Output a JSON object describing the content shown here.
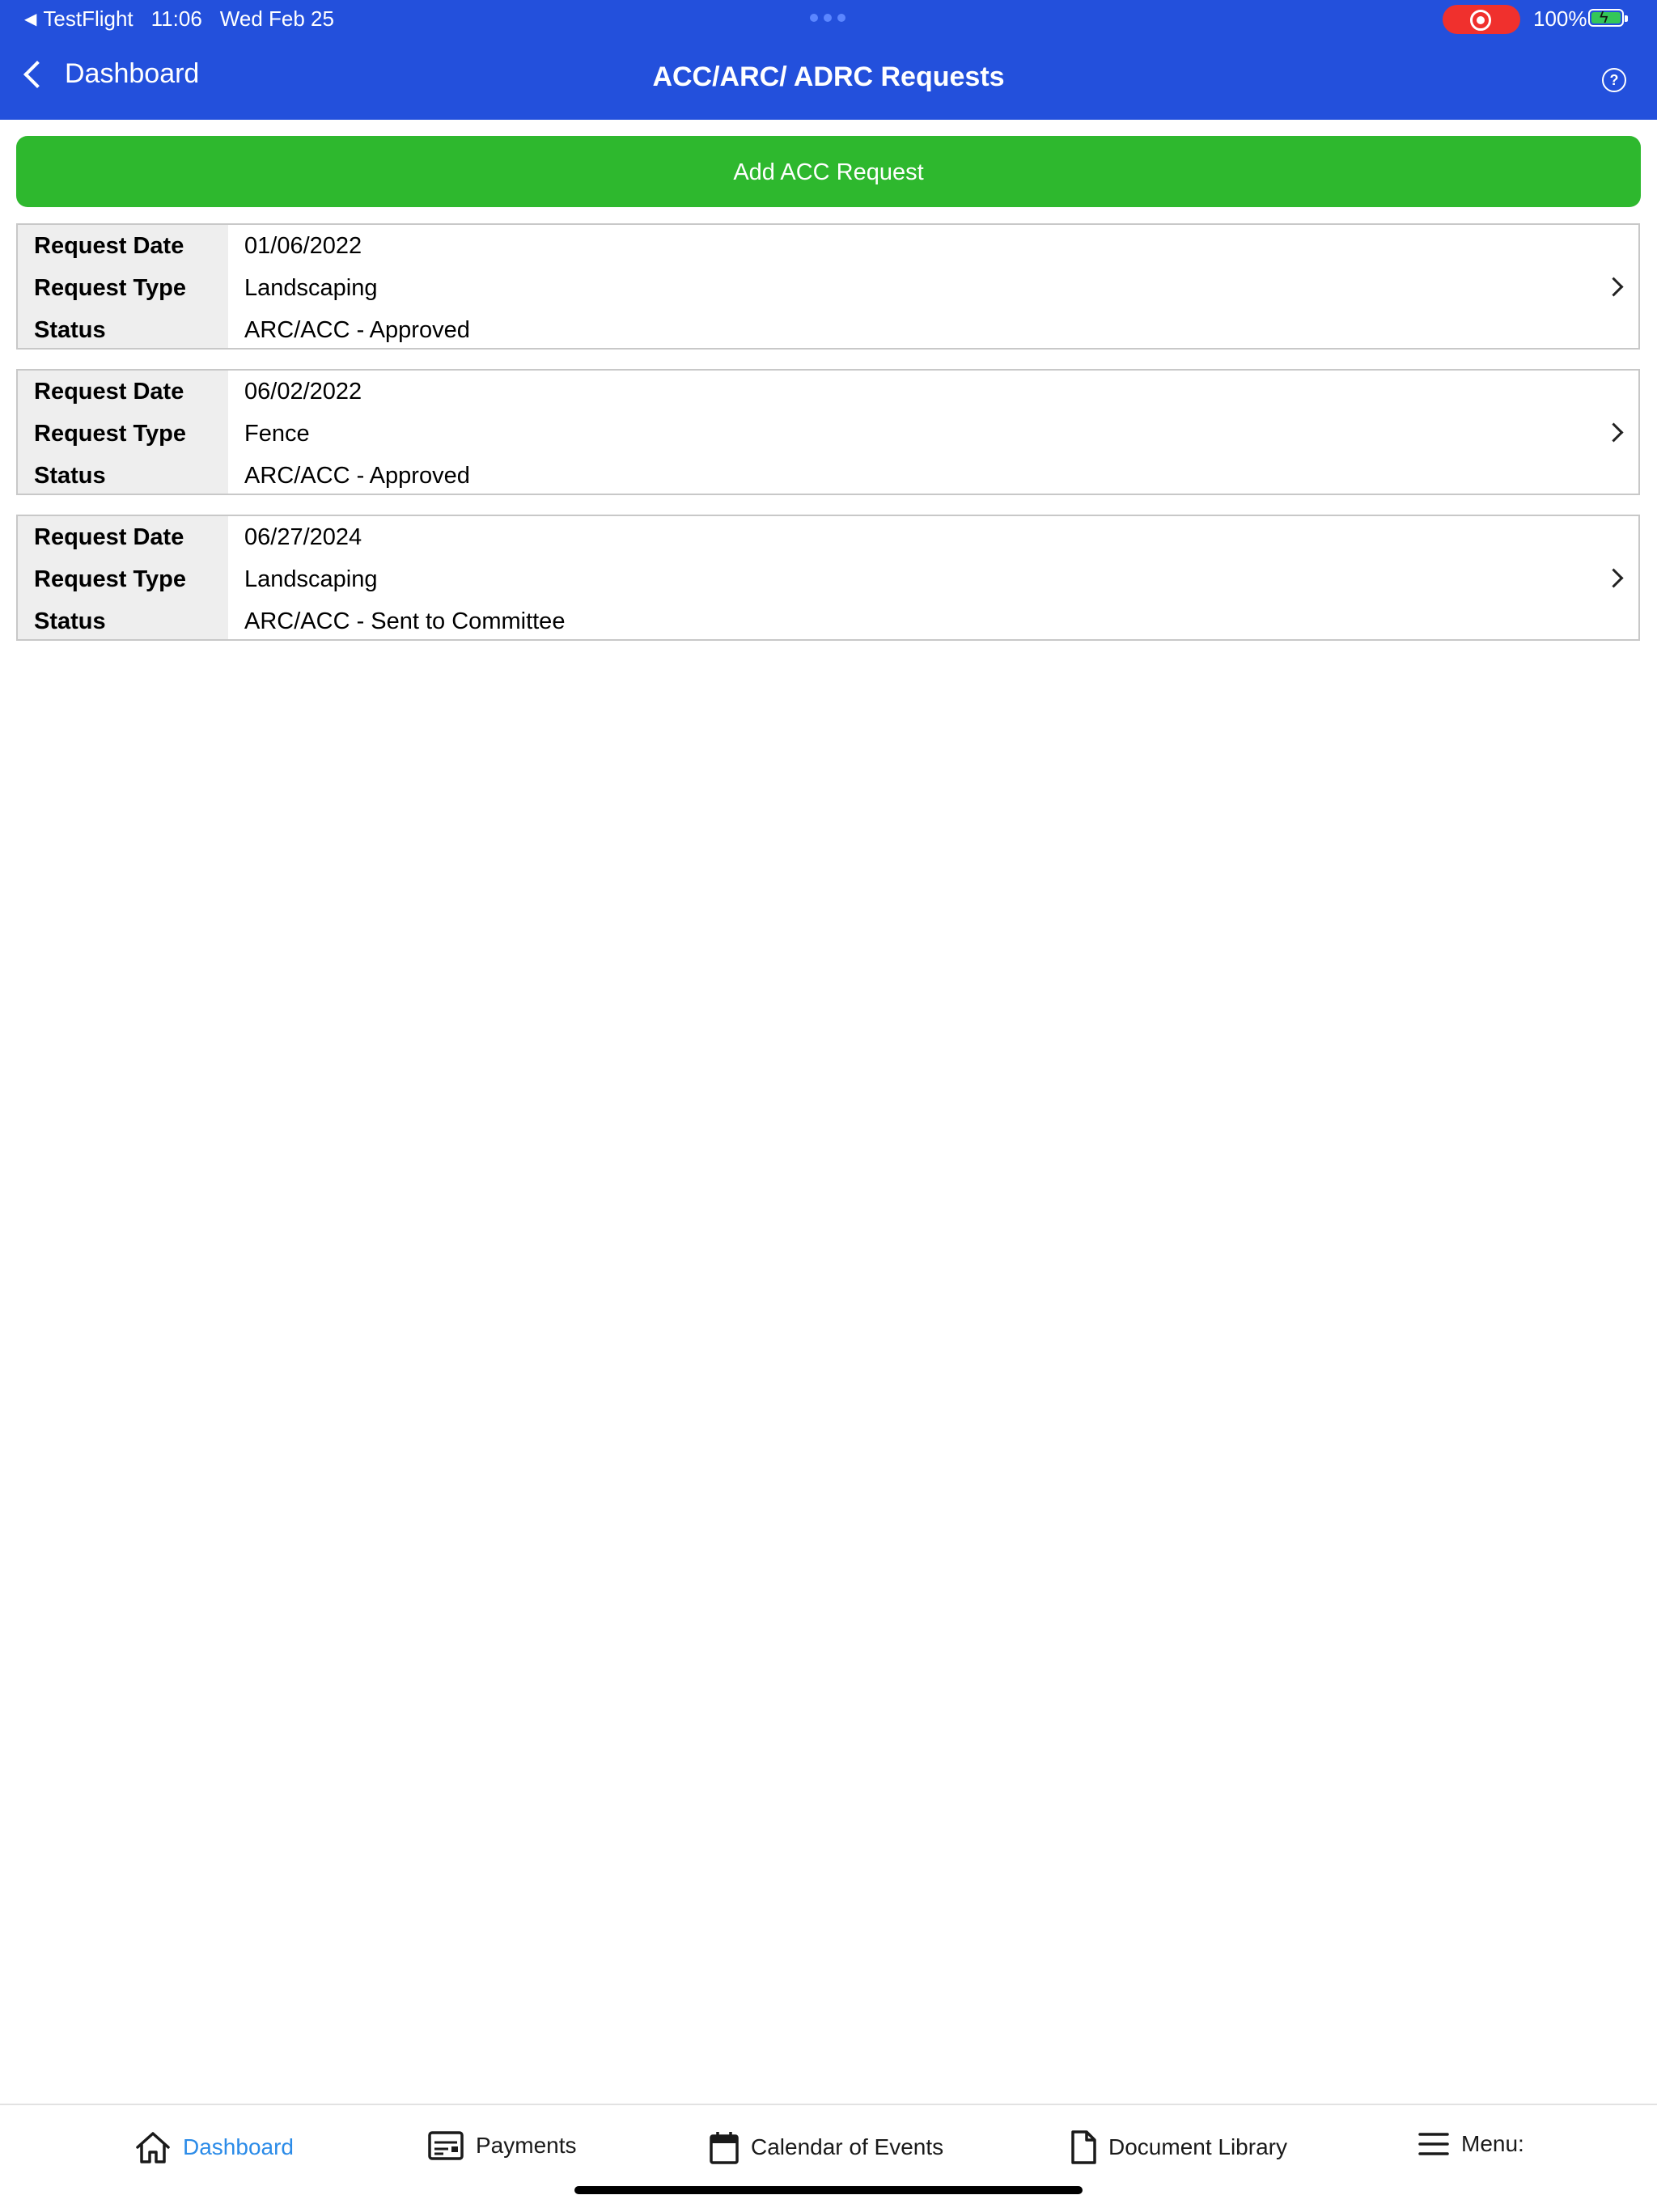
{
  "status_bar": {
    "back_app": "TestFlight",
    "time": "11:06",
    "date": "Wed Feb 25",
    "battery": "100%"
  },
  "nav": {
    "back_label": "Dashboard",
    "title": "ACC/ARC/ ADRC Requests"
  },
  "add_button_label": "Add ACC Request",
  "field_labels": {
    "request_date": "Request Date",
    "request_type": "Request Type",
    "status": "Status"
  },
  "requests": [
    {
      "date": "01/06/2022",
      "type": "Landscaping",
      "status": "ARC/ACC - Approved"
    },
    {
      "date": "06/02/2022",
      "type": "Fence",
      "status": "ARC/ACC - Approved"
    },
    {
      "date": "06/27/2024",
      "type": "Landscaping",
      "status": "ARC/ACC - Sent to Committee"
    }
  ],
  "tabs": [
    {
      "label": "Dashboard",
      "icon": "home-icon",
      "active": true
    },
    {
      "label": "Payments",
      "icon": "payments-icon",
      "active": false
    },
    {
      "label": "Calendar of Events",
      "icon": "calendar-icon",
      "active": false
    },
    {
      "label": "Document Library",
      "icon": "document-icon",
      "active": false
    },
    {
      "label": "Menu:",
      "icon": "menu-icon",
      "active": false
    }
  ],
  "colors": {
    "header_bg": "#2350dc",
    "add_button_bg": "#2eb82e",
    "active_tab": "#2b8be8",
    "label_cell_bg": "#eeeeee"
  }
}
